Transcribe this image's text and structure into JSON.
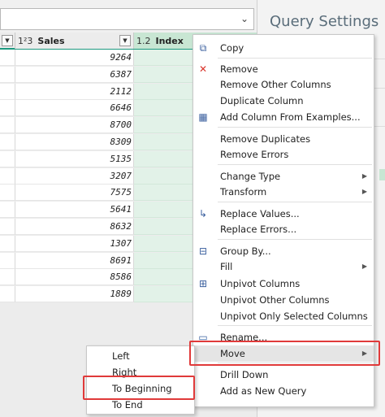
{
  "query_settings": {
    "title": "Query Settings"
  },
  "columns": [
    {
      "type_icon": "1²3",
      "name": "Sales"
    },
    {
      "type_icon": "1.2",
      "name": "Index"
    }
  ],
  "sales_values": [
    "9264",
    "6387",
    "2112",
    "6646",
    "8700",
    "8309",
    "5135",
    "3207",
    "7575",
    "5641",
    "8632",
    "1307",
    "8691",
    "8586",
    "1889"
  ],
  "context_menu": {
    "items": [
      {
        "label": "Copy",
        "icon": "copy-icon",
        "glyph": "⧉"
      },
      {
        "label": "Remove",
        "icon": "remove-icon",
        "glyph": "✕"
      },
      {
        "label": "Remove Other Columns"
      },
      {
        "label": "Duplicate Column"
      },
      {
        "label": "Add Column From Examples...",
        "icon": "add-column-icon",
        "glyph": "▦"
      },
      {
        "label": "Remove Duplicates"
      },
      {
        "label": "Remove Errors"
      },
      {
        "label": "Change Type",
        "submenu": true
      },
      {
        "label": "Transform",
        "submenu": true
      },
      {
        "label": "Replace Values...",
        "icon": "replace-values-icon",
        "glyph": "↳"
      },
      {
        "label": "Replace Errors..."
      },
      {
        "label": "Group By...",
        "icon": "group-by-icon",
        "glyph": "⊟"
      },
      {
        "label": "Fill",
        "submenu": true
      },
      {
        "label": "Unpivot Columns",
        "icon": "unpivot-icon",
        "glyph": "⊞"
      },
      {
        "label": "Unpivot Other Columns"
      },
      {
        "label": "Unpivot Only Selected Columns"
      },
      {
        "label": "Rename...",
        "icon": "rename-icon",
        "glyph": "▭"
      },
      {
        "label": "Move",
        "submenu": true
      },
      {
        "label": "Drill Down"
      },
      {
        "label": "Add as New Query"
      }
    ]
  },
  "move_submenu": {
    "items": [
      "Left",
      "Right",
      "To Beginning",
      "To End"
    ]
  },
  "colors": {
    "accent": "#1d9a80",
    "highlight_box": "#e03a3a",
    "index_column": "#c8e6d3"
  }
}
